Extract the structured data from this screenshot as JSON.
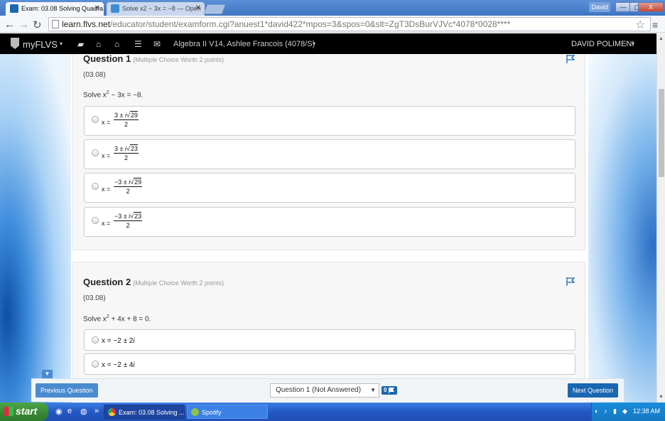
{
  "browser": {
    "tabs": [
      {
        "label": "Exam: 03.08 Solving Quadra",
        "active": true
      },
      {
        "label": "Solve x2 − 3x = −8 — Open",
        "active": false
      }
    ],
    "user": "David",
    "window_buttons": [
      "—",
      "▢",
      "X"
    ],
    "url_host": "learn.flvs.net",
    "url_path": "/educator/student/examform.cgi?anuest1*david422*mpos=3&spos=0&slt=ZgT3DsBurVJVc*4078*0028****"
  },
  "site": {
    "logo": "myFLVS",
    "course": "Algebra II V14, Ashlee Francois (4078/S)",
    "user": "DAVID POLIMENI",
    "caret": "▾"
  },
  "questions": [
    {
      "title": "Question 1",
      "meta": "(Multiple Choice Worth 2 points)",
      "code": "(03.08)",
      "prompt_prefix": "Solve x",
      "prompt_exp": "2",
      "prompt_suffix": " − 3x = −8.",
      "options": [
        {
          "x": "x =",
          "num_pre": "3 ± ",
          "num_i": "i",
          "num_rad": "29",
          "den": "2"
        },
        {
          "x": "x =",
          "num_pre": "3 ± ",
          "num_i": "i",
          "num_rad": "23",
          "den": "2"
        },
        {
          "x": "x =",
          "num_pre": "−3 ± ",
          "num_i": "i",
          "num_rad": "29",
          "den": "2"
        },
        {
          "x": "x =",
          "num_pre": "−3 ± ",
          "num_i": "i",
          "num_rad": "23",
          "den": "2"
        }
      ]
    },
    {
      "title": "Question 2",
      "meta": "(Multiple Choice Worth 2 points)",
      "code": "(03.08)",
      "prompt_prefix": "Solve x",
      "prompt_exp": "2",
      "prompt_suffix": " + 4x + 8 = 0.",
      "options": [
        {
          "expr": "x = −2 ± 2",
          "i": "i"
        },
        {
          "expr": "x = −2 ± 4",
          "i": "i"
        }
      ]
    }
  ],
  "footer": {
    "prev_label": "Previous Question",
    "next_label": "Next Question",
    "question_select": "Question 1 (Not Answered)",
    "flag_count": "0"
  },
  "taskbar": {
    "start": "start",
    "items": [
      {
        "label": "Exam: 03.08 Solving ...",
        "active": true
      },
      {
        "label": "Spotify",
        "active": false
      }
    ],
    "quick_more": "»",
    "clock": "12:38 AM"
  },
  "colors": {
    "accent": "#1a67b1",
    "header_bg": "#000000",
    "taskbar": "#2458c4",
    "start_green": "#3a8a36"
  }
}
